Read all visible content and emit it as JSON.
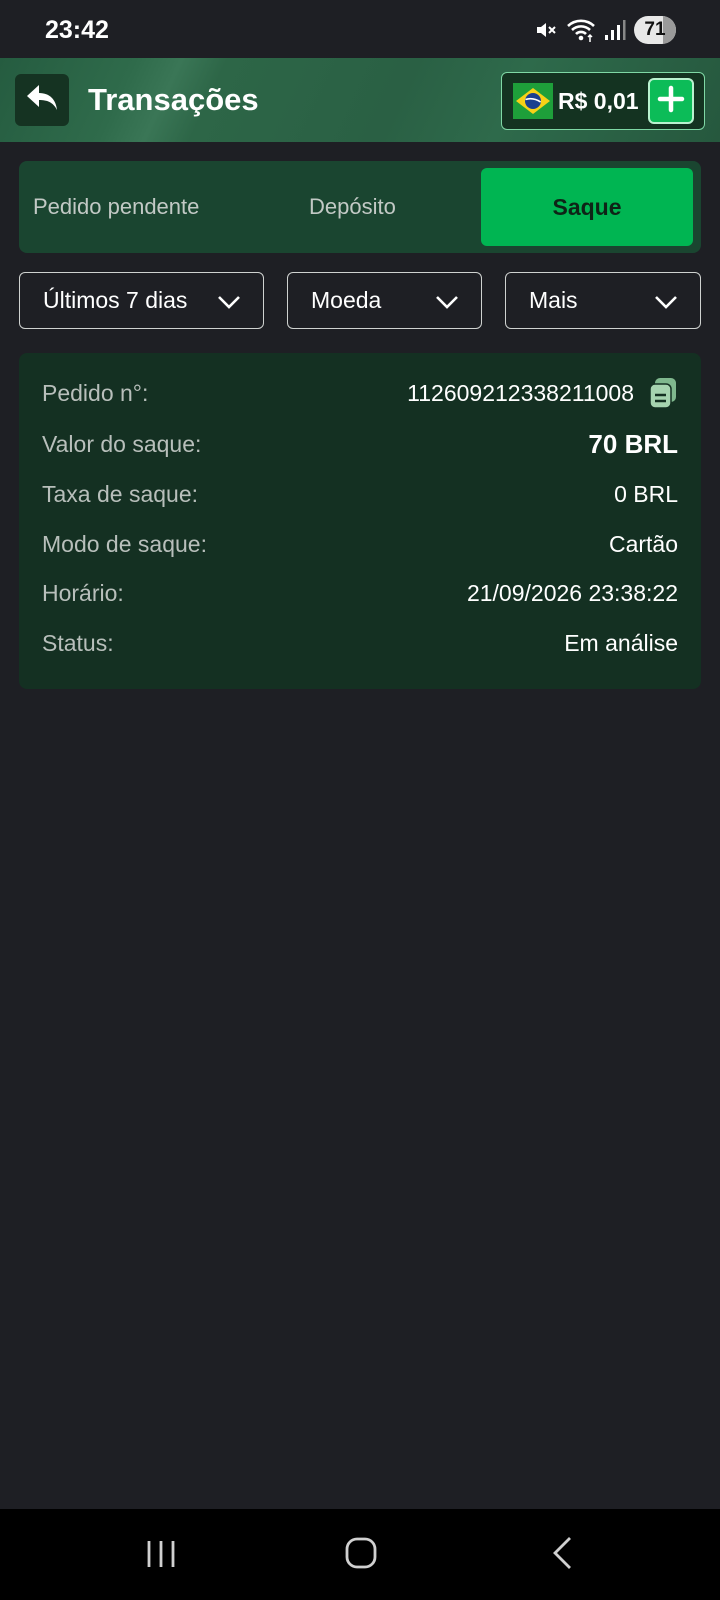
{
  "status_bar": {
    "time": "23:42",
    "battery_level": "71",
    "icons": [
      "mute-icon",
      "wifi-icon",
      "signal-icon",
      "battery-icon"
    ]
  },
  "header": {
    "title": "Transações",
    "balance": "R$ 0,01",
    "icons": [
      "back-arrow-icon",
      "brazil-flag-icon",
      "plus-icon"
    ]
  },
  "tabs": [
    {
      "label": "Pedido pendente",
      "active": false
    },
    {
      "label": "Depósito",
      "active": false
    },
    {
      "label": "Saque",
      "active": true
    }
  ],
  "filters": [
    {
      "label": "Últimos 7 dias"
    },
    {
      "label": "Moeda"
    },
    {
      "label": "Mais"
    }
  ],
  "transaction": {
    "order_label": "Pedido n°:",
    "order_value": "112609212338211008",
    "amount_label": "Valor do saque:",
    "amount_value": "70 BRL",
    "fee_label": "Taxa de saque:",
    "fee_value": "0 BRL",
    "mode_label": "Modo de saque:",
    "mode_value": "Cartão",
    "time_label": "Horário:",
    "time_value": "21/09/2026 23:38:22",
    "status_label": "Status:",
    "status_value": "Em análise"
  },
  "colors": {
    "background": "#1e1f24",
    "header_green": "#2a6044",
    "tab_active": "#00b552",
    "card": "#143022",
    "accent": "#0cbc58"
  }
}
